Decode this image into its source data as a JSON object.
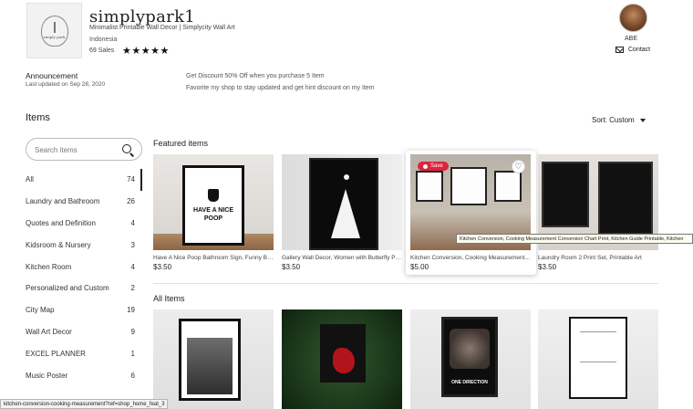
{
  "shop": {
    "name": "simplypark1",
    "tagline": "Minimalist Printable Wall Decor | Simplycity Wall Art",
    "location": "Indonesia",
    "sales": "69 Sales",
    "stars": "★★★★★",
    "logo_text": "simply park"
  },
  "owner": {
    "name": "ABE",
    "contact_label": "Contact"
  },
  "announcement": {
    "title": "Announcement",
    "updated": "Last updated on Sep 28, 2020",
    "line1": "Get Discount 50% Off when you purchase 5 Item",
    "line2": "Favorite my shop to stay updated and get hint discount on my Item"
  },
  "items_heading": "Items",
  "sort_label": "Sort: Custom",
  "search": {
    "placeholder": "Search items"
  },
  "categories": [
    {
      "label": "All",
      "count": "74"
    },
    {
      "label": "Laundry and Bathroom",
      "count": "26"
    },
    {
      "label": "Quotes and Definition",
      "count": "4"
    },
    {
      "label": "Kidsroom & Nursery",
      "count": "3"
    },
    {
      "label": "Kitchen Room",
      "count": "4"
    },
    {
      "label": "Personalized and Custom",
      "count": "2"
    },
    {
      "label": "City Map",
      "count": "19"
    },
    {
      "label": "Wall Art Decor",
      "count": "9"
    },
    {
      "label": "EXCEL PLANNER",
      "count": "1"
    },
    {
      "label": "Music Poster",
      "count": "6"
    }
  ],
  "featured": {
    "heading": "Featured items",
    "items": [
      {
        "title": "Have A Nice Poop Bathroom Sign, Funny Bathroom Wall Art",
        "price": "$3.50",
        "image_text": "HAVE A NICE POOP"
      },
      {
        "title": "Gallery Wall Decor, Women with Butterfly Printable",
        "price": "$3.50"
      },
      {
        "title": "Kitchen Conversion, Cooking Measurement Conversion Chart",
        "price": "$5.00",
        "save_label": "Save"
      },
      {
        "title": "Laundry Room 2 Print Set, Printable Art",
        "price": "$3.50"
      }
    ]
  },
  "tooltip": "Kitchen Conversion, Cooking Measurement Conversion Chart Print, Kitchen Guide Printable, Kitchen",
  "all_items": {
    "heading": "All Items",
    "band_text": "ONE DIRECTION"
  },
  "status_url": "kitchen-conversion-cooking-measurement?ref=shop_home_feat_3"
}
